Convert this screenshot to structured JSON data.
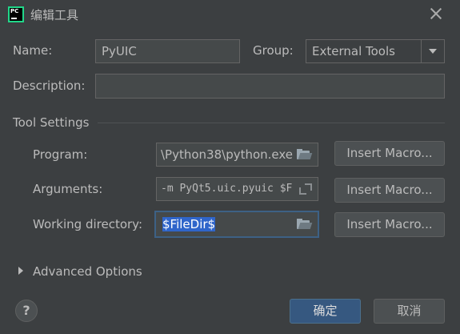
{
  "window": {
    "title": "编辑工具",
    "app_icon_text": "PC"
  },
  "form": {
    "name_label": "Name:",
    "name_value": "PyUIC",
    "group_label": "Group:",
    "group_value": "External Tools",
    "description_label": "Description:",
    "description_value": ""
  },
  "tool_settings": {
    "section_title": "Tool Settings",
    "program_label": "Program:",
    "program_value": "\\Python38\\python.exe",
    "arguments_label": "Arguments:",
    "arguments_value": "-m PyQt5.uic.pyuic $F",
    "working_dir_label": "Working directory:",
    "working_dir_value": "$FileDir$",
    "insert_macro_label": "Insert Macro..."
  },
  "advanced": {
    "label": "Advanced Options"
  },
  "footer": {
    "help_label": "?",
    "ok_label": "确定",
    "cancel_label": "取消"
  },
  "colors": {
    "background": "#3c3f41",
    "field_bg": "#45494a",
    "primary_button": "#365880",
    "selection": "#2f65ca",
    "focus_border": "#3d6185"
  },
  "icons": [
    "close-icon",
    "folder-icon",
    "expand-icon",
    "help-icon",
    "chevron-down-icon",
    "chevron-right-icon"
  ]
}
